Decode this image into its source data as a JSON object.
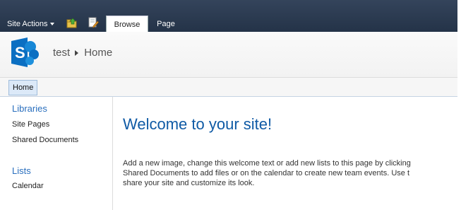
{
  "ribbon": {
    "site_actions_label": "Site Actions",
    "tabs": [
      {
        "label": "Browse",
        "selected": true
      },
      {
        "label": "Page",
        "selected": false
      }
    ],
    "icons": [
      "navigate-up-icon",
      "edit-page-icon"
    ]
  },
  "title_area": {
    "site_name": "test",
    "page_name": "Home"
  },
  "topnav": {
    "home_label": "Home"
  },
  "quicklaunch": {
    "libraries_heading": "Libraries",
    "library_items": [
      "Site Pages",
      "Shared Documents"
    ],
    "lists_heading": "Lists",
    "list_items": [
      "Calendar"
    ]
  },
  "main": {
    "welcome_title": "Welcome to your site!",
    "welcome_lines": [
      "Add a new image, change this welcome text or add new lists to this page by clicking",
      "Shared Documents to add files or on the calendar to create new team events. Use t",
      "share your site and customize its look."
    ]
  },
  "colors": {
    "ribbon_bg": "#243348",
    "heading_blue": "#0f5aa5",
    "logo_blue": "#0072c6"
  }
}
